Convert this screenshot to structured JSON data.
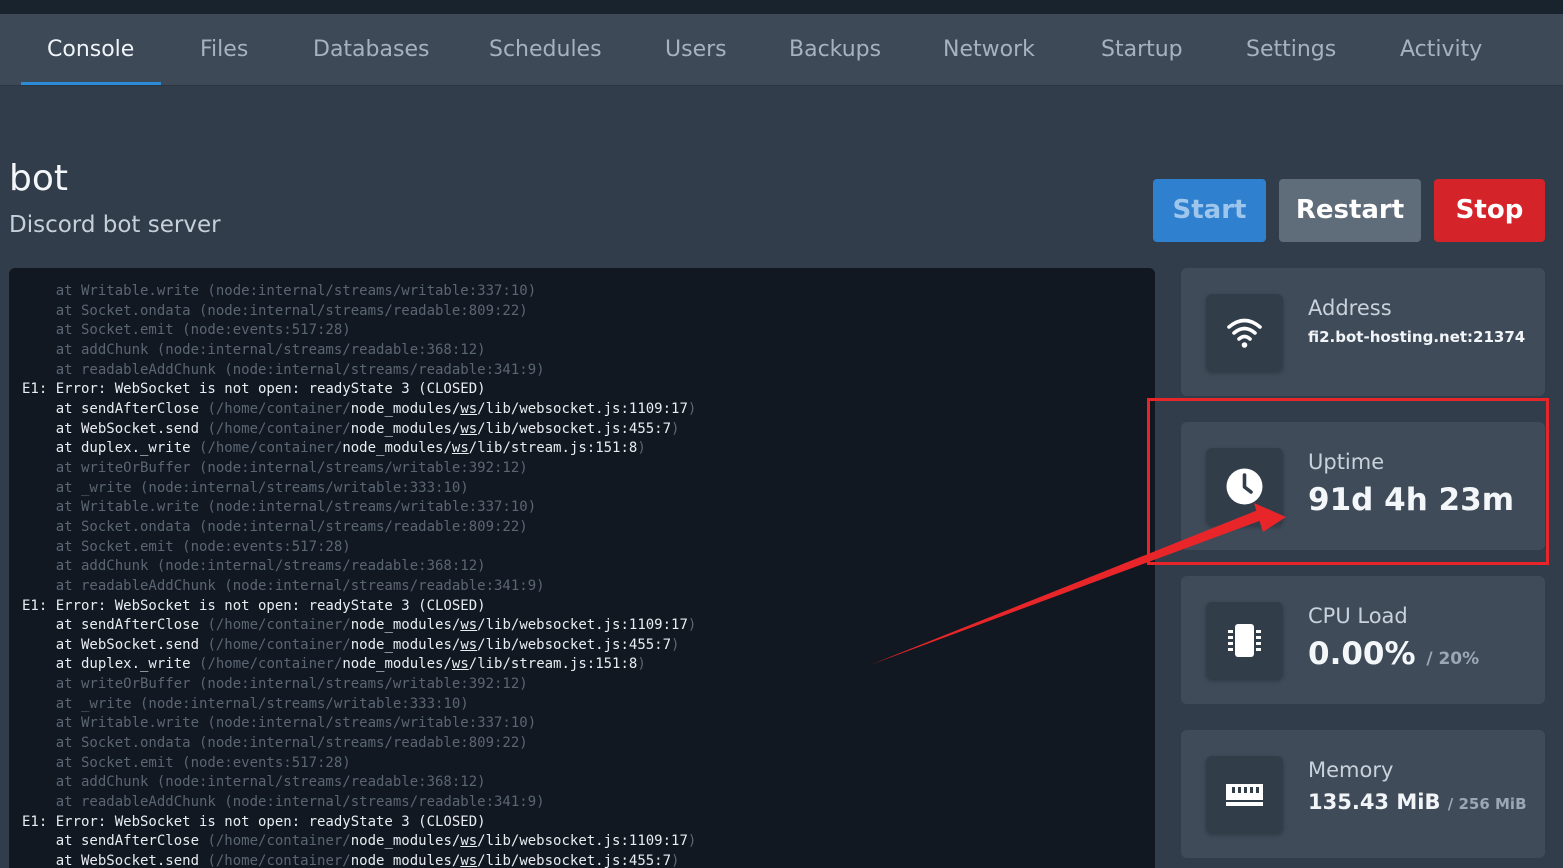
{
  "tabs": [
    {
      "label": "Console"
    },
    {
      "label": "Files"
    },
    {
      "label": "Databases"
    },
    {
      "label": "Schedules"
    },
    {
      "label": "Users"
    },
    {
      "label": "Backups"
    },
    {
      "label": "Network"
    },
    {
      "label": "Startup"
    },
    {
      "label": "Settings"
    },
    {
      "label": "Activity"
    }
  ],
  "server": {
    "name": "bot",
    "description": "Discord bot server"
  },
  "controls": {
    "start": "Start",
    "restart": "Restart",
    "stop": "Stop"
  },
  "console": {
    "lines": [
      {
        "t": "m",
        "text": "    at Writable.write (node:internal/streams/writable:337:10)"
      },
      {
        "t": "m",
        "text": "    at Socket.ondata (node:internal/streams/readable:809:22)"
      },
      {
        "t": "m",
        "text": "    at Socket.emit (node:events:517:28)"
      },
      {
        "t": "m",
        "text": "    at addChunk (node:internal/streams/readable:368:12)"
      },
      {
        "t": "m",
        "text": "    at readableAddChunk (node:internal/streams/readable:341:9)"
      },
      {
        "t": "err",
        "text": "E1: Error: WebSocket is not open: readyState 3 (CLOSED)"
      },
      {
        "t": "stack",
        "fn": "    at sendAfterClose ",
        "file": "lib/websocket.js:1109:17"
      },
      {
        "t": "stack",
        "fn": "    at WebSocket.send ",
        "file": "lib/websocket.js:455:7"
      },
      {
        "t": "stack",
        "fn": "    at duplex._write ",
        "file": "lib/stream.js:151:8"
      },
      {
        "t": "m",
        "text": "    at writeOrBuffer (node:internal/streams/writable:392:12)"
      },
      {
        "t": "m",
        "text": "    at _write (node:internal/streams/writable:333:10)"
      },
      {
        "t": "m",
        "text": "    at Writable.write (node:internal/streams/writable:337:10)"
      },
      {
        "t": "m",
        "text": "    at Socket.ondata (node:internal/streams/readable:809:22)"
      },
      {
        "t": "m",
        "text": "    at Socket.emit (node:events:517:28)"
      },
      {
        "t": "m",
        "text": "    at addChunk (node:internal/streams/readable:368:12)"
      },
      {
        "t": "m",
        "text": "    at readableAddChunk (node:internal/streams/readable:341:9)"
      },
      {
        "t": "err",
        "text": "E1: Error: WebSocket is not open: readyState 3 (CLOSED)"
      },
      {
        "t": "stack",
        "fn": "    at sendAfterClose ",
        "file": "lib/websocket.js:1109:17"
      },
      {
        "t": "stack",
        "fn": "    at WebSocket.send ",
        "file": "lib/websocket.js:455:7"
      },
      {
        "t": "stack",
        "fn": "    at duplex._write ",
        "file": "lib/stream.js:151:8"
      },
      {
        "t": "m",
        "text": "    at writeOrBuffer (node:internal/streams/writable:392:12)"
      },
      {
        "t": "m",
        "text": "    at _write (node:internal/streams/writable:333:10)"
      },
      {
        "t": "m",
        "text": "    at Writable.write (node:internal/streams/writable:337:10)"
      },
      {
        "t": "m",
        "text": "    at Socket.ondata (node:internal/streams/readable:809:22)"
      },
      {
        "t": "m",
        "text": "    at Socket.emit (node:events:517:28)"
      },
      {
        "t": "m",
        "text": "    at addChunk (node:internal/streams/readable:368:12)"
      },
      {
        "t": "m",
        "text": "    at readableAddChunk (node:internal/streams/readable:341:9)"
      },
      {
        "t": "err",
        "text": "E1: Error: WebSocket is not open: readyState 3 (CLOSED)"
      },
      {
        "t": "stack",
        "fn": "    at sendAfterClose ",
        "file": "lib/websocket.js:1109:17"
      },
      {
        "t": "stack",
        "fn": "    at WebSocket.send ",
        "file": "lib/websocket.js:455:7"
      }
    ],
    "path_prefix": "(/home/container/",
    "path_module": "node_modules/",
    "path_ws": "ws",
    "path_sep": "/",
    "path_close": ")"
  },
  "stats": {
    "address": {
      "label": "Address",
      "value": "fi2.bot-hosting.net:21374",
      "icon": "wifi-icon"
    },
    "uptime": {
      "label": "Uptime",
      "value": "91d 4h 23m",
      "icon": "clock-icon"
    },
    "cpu": {
      "label": "CPU Load",
      "value": "0.00%",
      "limit": "/ 20%",
      "icon": "cpu-icon"
    },
    "memory": {
      "label": "Memory",
      "value": "135.43 MiB",
      "limit": "/ 256 MiB",
      "icon": "memory-icon"
    }
  },
  "colors": {
    "accent": "#2c8bd6",
    "start": "#2f80ce",
    "restart": "#5f6c7a",
    "stop": "#d5232a",
    "annotation": "#e8262a"
  }
}
